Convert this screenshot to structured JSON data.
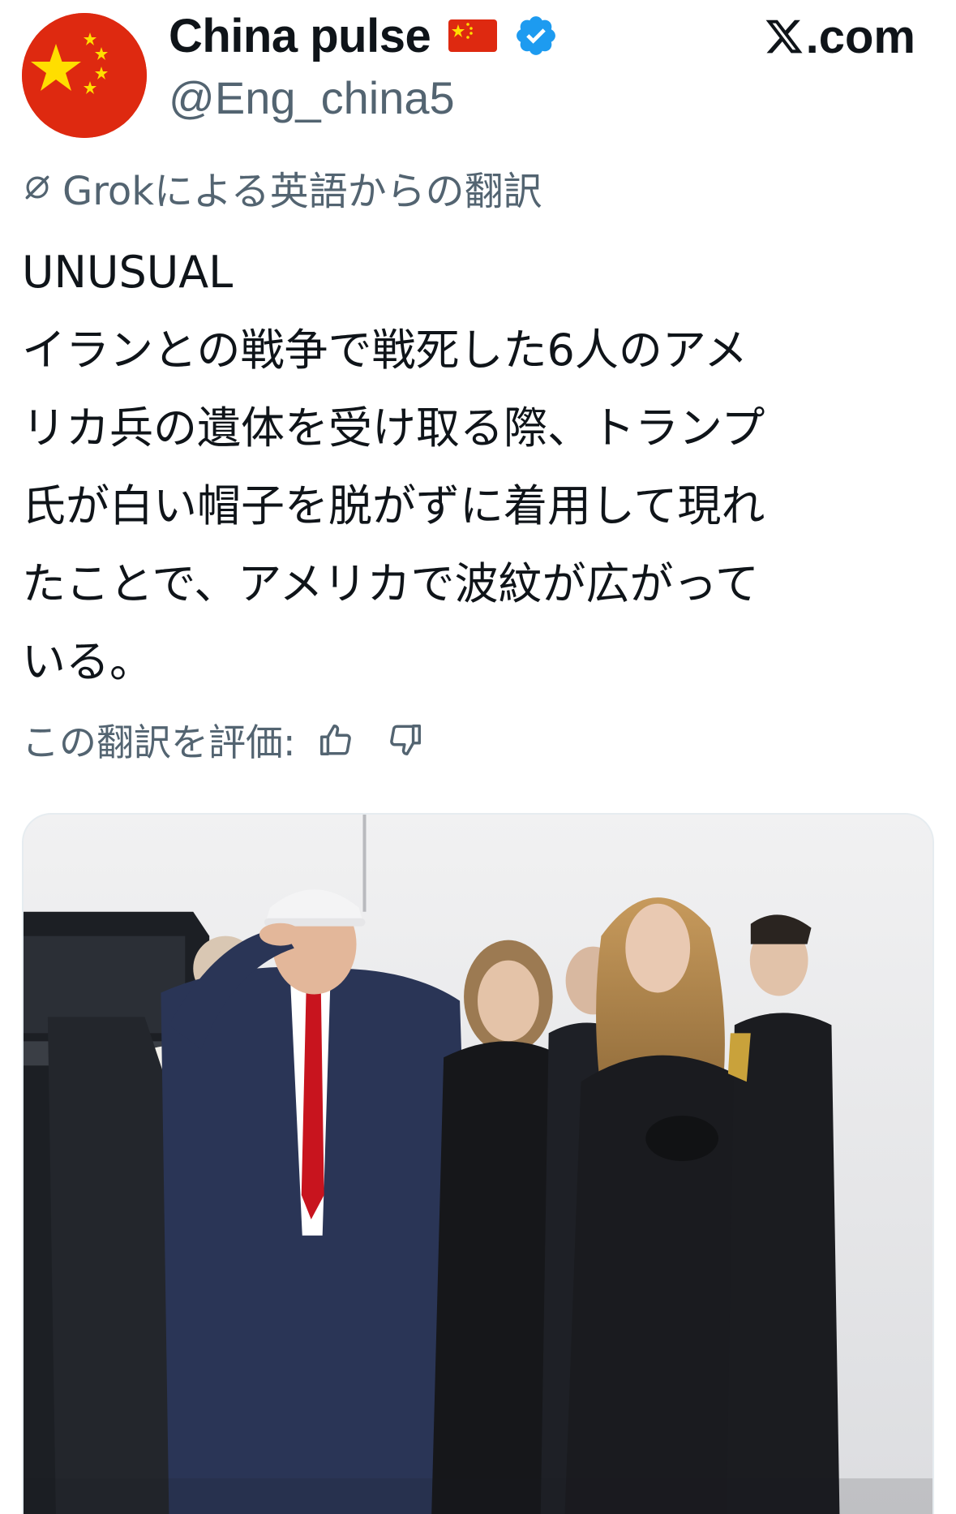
{
  "author": {
    "display_name": "China pulse",
    "handle": "@Eng_china5",
    "avatar_icon": "china-flag-avatar",
    "flag_icon": "china-flag-icon",
    "verified_icon": "verified-badge-icon",
    "verified_color": "#1d9bf0"
  },
  "brand": {
    "logo_icon": "x-logo-icon",
    "suffix": ".com"
  },
  "translation_notice": {
    "icon": "grok-icon",
    "text": "Grokによる英語からの翻訳"
  },
  "tweet": {
    "lines": [
      "UNUSUAL",
      "イランとの戦争で戦死した6人のアメ",
      "リカ兵の遺体を受け取る際、トランプ",
      "氏が白い帽子を脱がずに着用して現れ",
      "たことで、アメリカで波紋が広がって",
      "いる。"
    ]
  },
  "rate_translation": {
    "label": "この翻訳を評価:",
    "thumbs_up_icon": "thumbs-up-icon",
    "thumbs_down_icon": "thumbs-down-icon"
  },
  "media": {
    "type": "photo",
    "description_icon": "ceremony-photo"
  },
  "colors": {
    "text_primary": "#0f1419",
    "text_secondary": "#536471",
    "china_red": "#de2910",
    "china_yellow": "#ffde00"
  }
}
